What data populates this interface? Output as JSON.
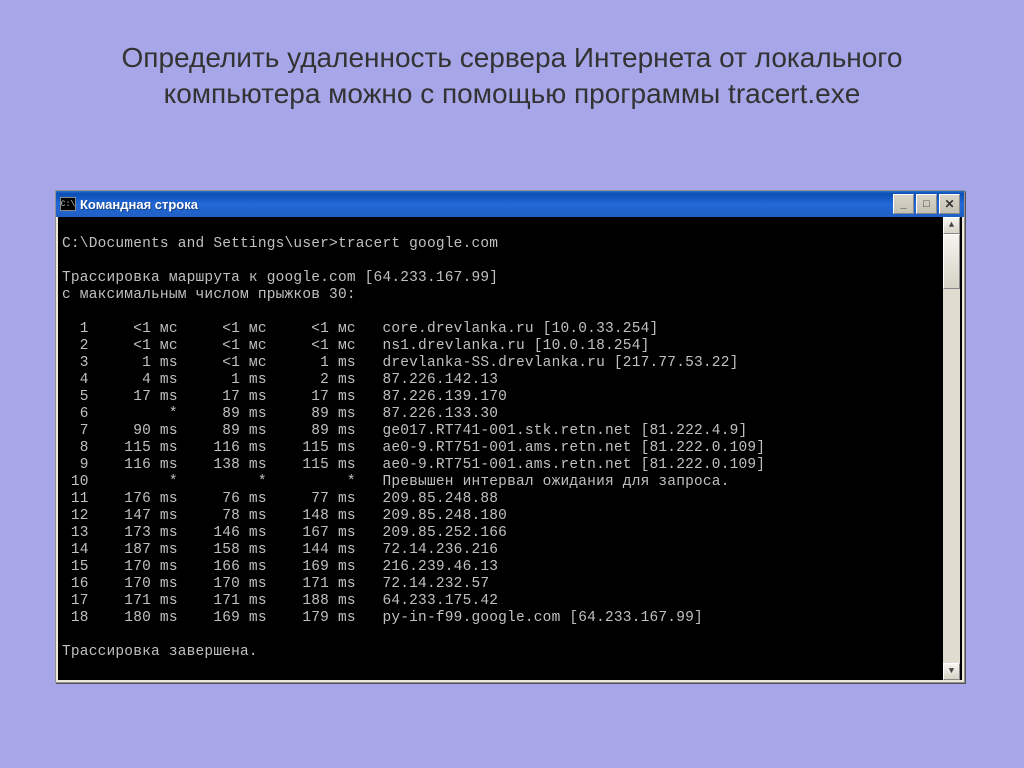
{
  "slide": {
    "title": "Определить удаленность сервера Интернета от локального компьютера можно с помощью программы tracert.exe"
  },
  "window": {
    "title": "Командная строка",
    "icon_label": "C:\\"
  },
  "console": {
    "prompt": "C:\\Documents and Settings\\user>tracert google.com",
    "header1": "Трассировка маршрута к google.com [64.233.167.99]",
    "header2": "с максимальным числом прыжков 30:",
    "footer": "Трассировка завершена.",
    "hops": [
      {
        "n": "1",
        "t1": "<1 мс",
        "t2": "<1 мс",
        "t3": "<1 мс",
        "host": "core.drevlanka.ru [10.0.33.254]"
      },
      {
        "n": "2",
        "t1": "<1 мс",
        "t2": "<1 мс",
        "t3": "<1 мс",
        "host": "ns1.drevlanka.ru [10.0.18.254]"
      },
      {
        "n": "3",
        "t1": "1 ms",
        "t2": "<1 мс",
        "t3": "1 ms",
        "host": "drevlanka-SS.drevlanka.ru [217.77.53.22]"
      },
      {
        "n": "4",
        "t1": "4 ms",
        "t2": "1 ms",
        "t3": "2 ms",
        "host": "87.226.142.13"
      },
      {
        "n": "5",
        "t1": "17 ms",
        "t2": "17 ms",
        "t3": "17 ms",
        "host": "87.226.139.170"
      },
      {
        "n": "6",
        "t1": "*",
        "t2": "89 ms",
        "t3": "89 ms",
        "host": "87.226.133.30"
      },
      {
        "n": "7",
        "t1": "90 ms",
        "t2": "89 ms",
        "t3": "89 ms",
        "host": "ge017.RT741-001.stk.retn.net [81.222.4.9]"
      },
      {
        "n": "8",
        "t1": "115 ms",
        "t2": "116 ms",
        "t3": "115 ms",
        "host": "ae0-9.RT751-001.ams.retn.net [81.222.0.109]"
      },
      {
        "n": "9",
        "t1": "116 ms",
        "t2": "138 ms",
        "t3": "115 ms",
        "host": "ae0-9.RT751-001.ams.retn.net [81.222.0.109]"
      },
      {
        "n": "10",
        "t1": "*",
        "t2": "*",
        "t3": "*",
        "host": "Превышен интервал ожидания для запроса."
      },
      {
        "n": "11",
        "t1": "176 ms",
        "t2": "76 ms",
        "t3": "77 ms",
        "host": "209.85.248.88"
      },
      {
        "n": "12",
        "t1": "147 ms",
        "t2": "78 ms",
        "t3": "148 ms",
        "host": "209.85.248.180"
      },
      {
        "n": "13",
        "t1": "173 ms",
        "t2": "146 ms",
        "t3": "167 ms",
        "host": "209.85.252.166"
      },
      {
        "n": "14",
        "t1": "187 ms",
        "t2": "158 ms",
        "t3": "144 ms",
        "host": "72.14.236.216"
      },
      {
        "n": "15",
        "t1": "170 ms",
        "t2": "166 ms",
        "t3": "169 ms",
        "host": "216.239.46.13"
      },
      {
        "n": "16",
        "t1": "170 ms",
        "t2": "170 ms",
        "t3": "171 ms",
        "host": "72.14.232.57"
      },
      {
        "n": "17",
        "t1": "171 ms",
        "t2": "171 ms",
        "t3": "188 ms",
        "host": "64.233.175.42"
      },
      {
        "n": "18",
        "t1": "180 ms",
        "t2": "169 ms",
        "t3": "179 ms",
        "host": "py-in-f99.google.com [64.233.167.99]"
      }
    ]
  }
}
